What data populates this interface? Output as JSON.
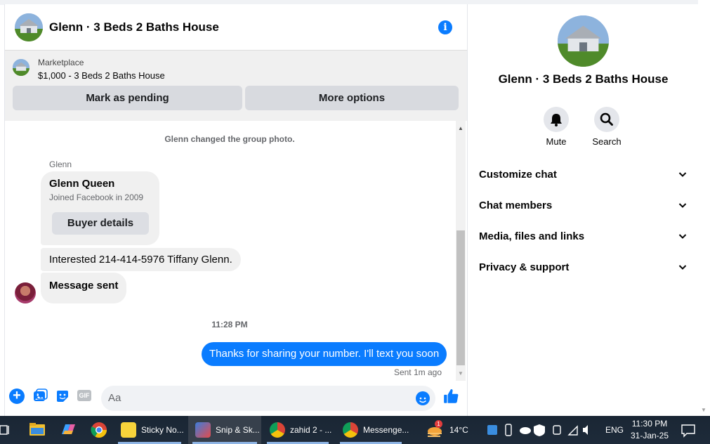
{
  "chat": {
    "title": "Glenn · 3 Beds 2 Baths House",
    "marketplace": {
      "label": "Marketplace",
      "listing": "$1,000 - 3 Beds 2 Baths House",
      "pending_button": "Mark as pending",
      "more_button": "More options"
    },
    "messages": {
      "system_event": "Glenn changed the group photo.",
      "sender_name": "Glenn",
      "card": {
        "name": "Glenn Queen",
        "subtitle": "Joined Facebook in 2009",
        "button": "Buyer details"
      },
      "incoming": [
        "Interested 214-414-5976 Tiffany Glenn.",
        "Message sent"
      ],
      "time_separator": "11:28 PM",
      "outgoing": "Thanks for sharing your number. I'll text you soon",
      "sent_status": "Sent 1m ago"
    },
    "composer": {
      "placeholder": "Aa",
      "gif_label": "GIF"
    }
  },
  "panel": {
    "title": "Glenn · 3 Beds 2 Baths House",
    "actions": {
      "mute": "Mute",
      "search": "Search"
    },
    "sections": [
      "Customize chat",
      "Chat members",
      "Media, files and links",
      "Privacy & support"
    ]
  },
  "taskbar": {
    "apps": [
      "Sticky No...",
      "Snip & Sk...",
      "zahid 2 - ...",
      "Messenge..."
    ],
    "weather": "14°C",
    "weather_badge": "1",
    "language": "ENG",
    "time": "11:30 PM",
    "date": "31-Jan-25"
  },
  "colors": {
    "accent": "#0a7cff",
    "bubble_in": "#f0f0f0",
    "taskbar": "#1e2b3a"
  }
}
